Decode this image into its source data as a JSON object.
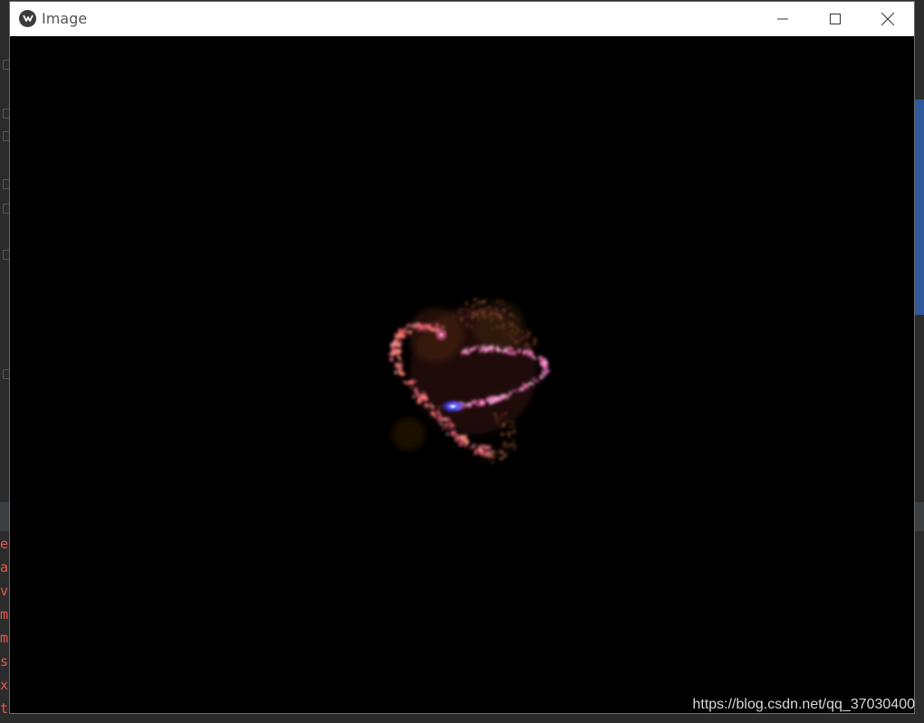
{
  "window": {
    "title": "Image",
    "controls": {
      "minimize": "minimize-icon",
      "maximize": "maximize-icon",
      "close": "close-icon"
    }
  },
  "background_console": {
    "lines": [
      "er",
      "ar",
      "ve",
      "ma",
      "ma",
      " s",
      "xe",
      "tc"
    ],
    "color": "#e05a4f"
  },
  "watermark": {
    "text": "https://blog.csdn.net/qq_37030400"
  },
  "render": {
    "background": "#000000",
    "ring_color": "#e8607a",
    "core_color": "#3a3aff"
  }
}
